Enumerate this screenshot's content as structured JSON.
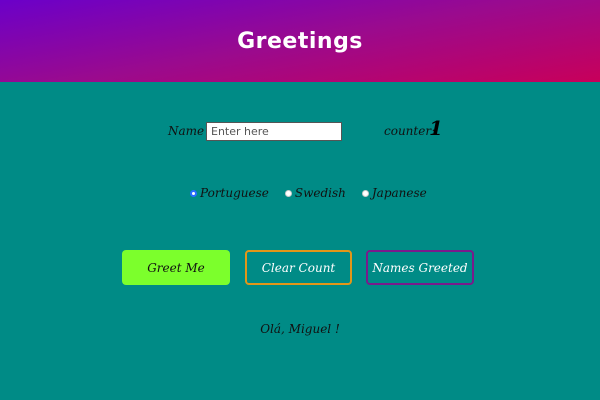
{
  "header": {
    "title": "Greetings"
  },
  "form": {
    "name_label": "Name",
    "name_placeholder": "Enter here",
    "counter_label": "counter:",
    "counter_value": "1"
  },
  "languages": [
    {
      "label": "Portuguese",
      "checked": true
    },
    {
      "label": "Swedish",
      "checked": false
    },
    {
      "label": "Japanese",
      "checked": false
    }
  ],
  "buttons": {
    "greet": "Greet Me",
    "clear": "Clear Count",
    "names": "Names Greeted"
  },
  "greeting": "Olá, Miguel !",
  "colors": {
    "background": "#008b86",
    "header_start": "#6b00c9",
    "header_end": "#c8005a",
    "greet_button": "#7cff2c",
    "clear_border": "#e39618",
    "names_border": "#7a1a8c"
  }
}
